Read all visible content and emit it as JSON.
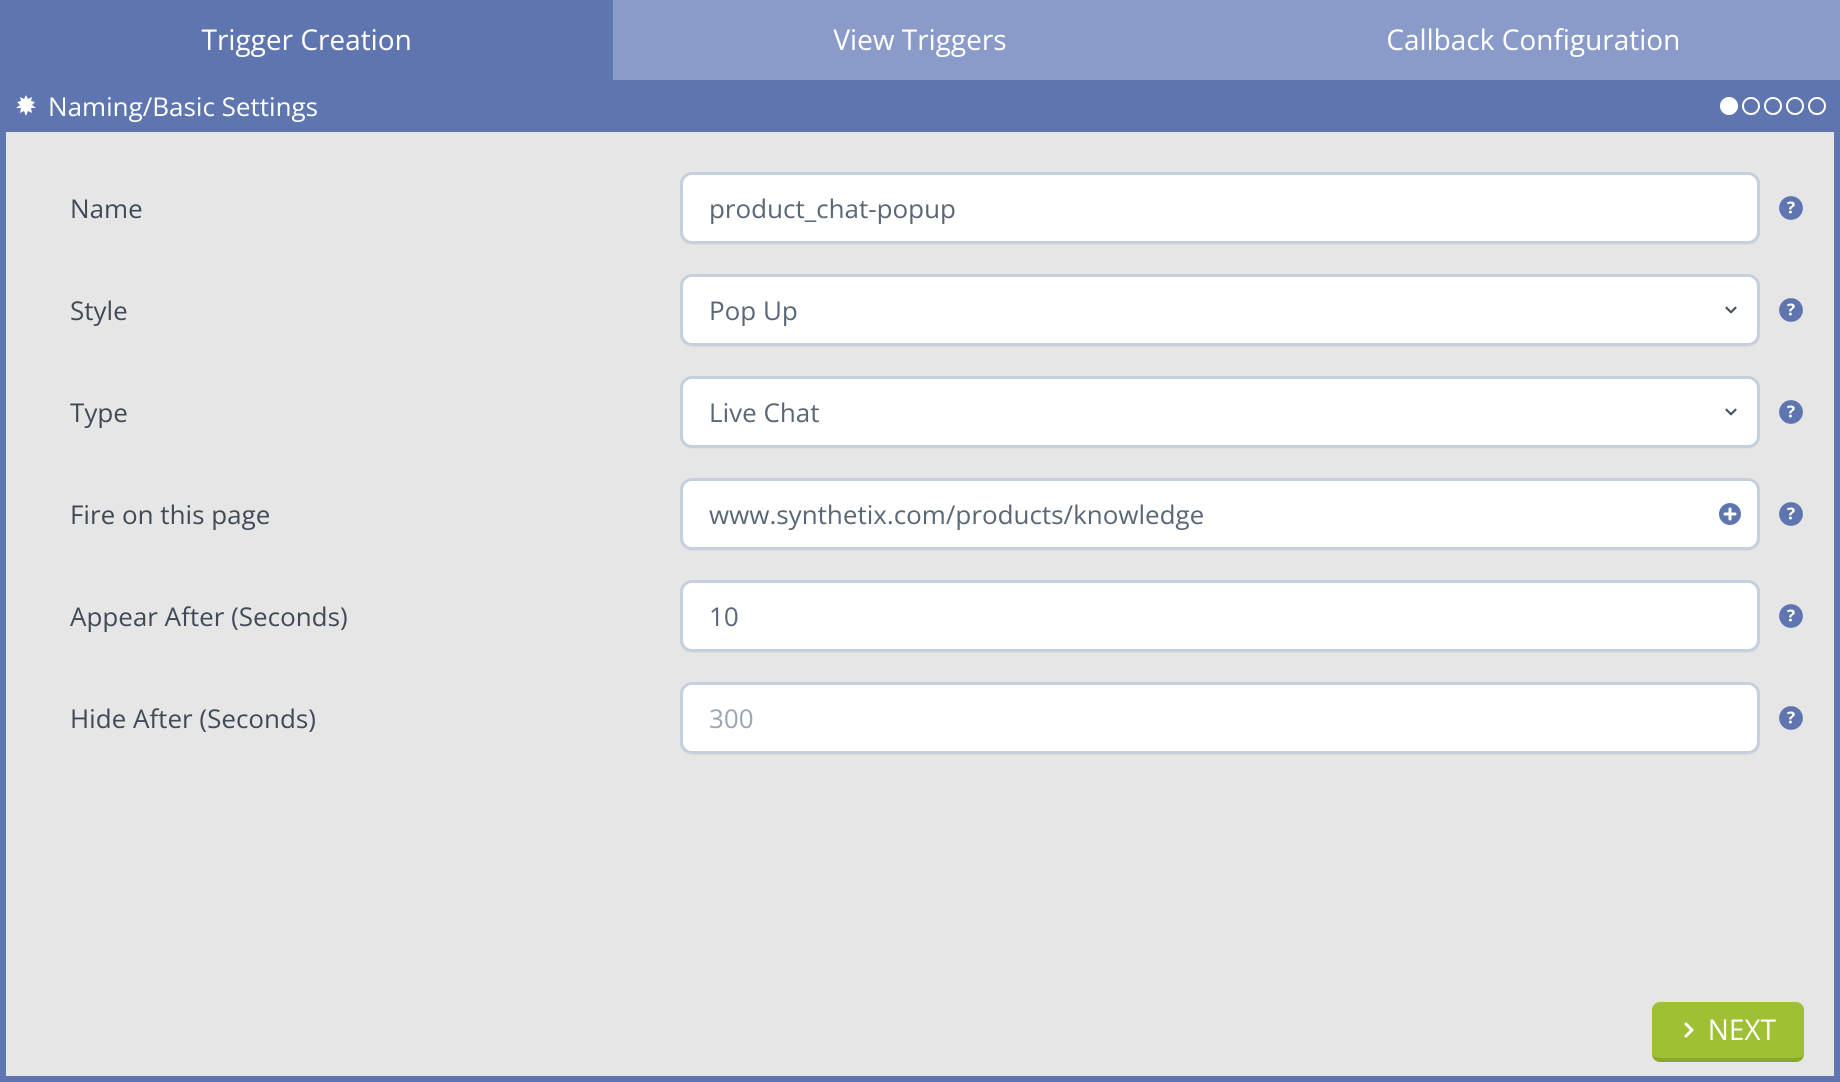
{
  "tabs": [
    {
      "label": "Trigger Creation",
      "active": true
    },
    {
      "label": "View Triggers",
      "active": false
    },
    {
      "label": "Callback Configuration",
      "active": false
    }
  ],
  "section": {
    "title": "Naming/Basic Settings",
    "progress_total": 5,
    "progress_current": 1
  },
  "form": {
    "name": {
      "label": "Name",
      "value": "product_chat-popup"
    },
    "style": {
      "label": "Style",
      "value": "Pop Up"
    },
    "type": {
      "label": "Type",
      "value": "Live Chat"
    },
    "fire_page": {
      "label": "Fire on this page",
      "value": "www.synthetix.com/products/knowledge"
    },
    "appear_after": {
      "label": "Appear After (Seconds)",
      "value": "10"
    },
    "hide_after": {
      "label": "Hide After (Seconds)",
      "value": "",
      "placeholder": "300"
    }
  },
  "footer": {
    "next_label": "NEXT"
  }
}
